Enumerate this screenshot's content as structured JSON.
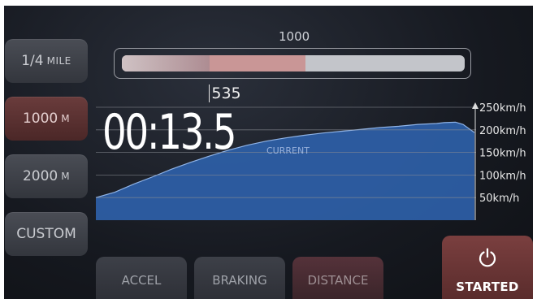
{
  "distance_options": [
    {
      "value": "1/4",
      "unit": "MILE"
    },
    {
      "value": "1000",
      "unit": "M",
      "selected": true
    },
    {
      "value": "2000",
      "unit": "M"
    },
    {
      "value": "CUSTOM",
      "unit": ""
    }
  ],
  "progress": {
    "target_label": "1000",
    "target": 1000,
    "current": 535,
    "current_label": "535"
  },
  "timer": "00:13.5",
  "chart_data": {
    "type": "area",
    "title": "",
    "xlabel": "",
    "ylabel": "",
    "ylim": [
      0,
      250
    ],
    "y_ticks": [
      50,
      100,
      150,
      200,
      250
    ],
    "y_tick_labels": [
      "50km/h",
      "100km/h",
      "150km/h",
      "200km/h",
      "250km/h"
    ],
    "annotation": "CURRENT",
    "x": [
      0,
      0.05,
      0.1,
      0.15,
      0.2,
      0.25,
      0.3,
      0.35,
      0.4,
      0.45,
      0.5,
      0.55,
      0.6,
      0.65,
      0.7,
      0.75,
      0.8,
      0.85,
      0.9,
      0.92,
      0.95,
      0.97,
      1.0
    ],
    "values": [
      50,
      62,
      80,
      96,
      113,
      128,
      142,
      155,
      166,
      175,
      182,
      188,
      193,
      197,
      201,
      205,
      208,
      212,
      214,
      216,
      217,
      212,
      194
    ]
  },
  "mode_tabs": [
    "ACCEL",
    "BRAKING",
    "DISTANCE"
  ],
  "active_tab": "DISTANCE",
  "start_button": {
    "label": "STARTED",
    "icon": "power-icon"
  },
  "colors": {
    "area_fill": "#2e5fa8",
    "area_line": "#8fb3e6",
    "active_red": "#6a3c3c",
    "grid": "#8a8d94"
  }
}
